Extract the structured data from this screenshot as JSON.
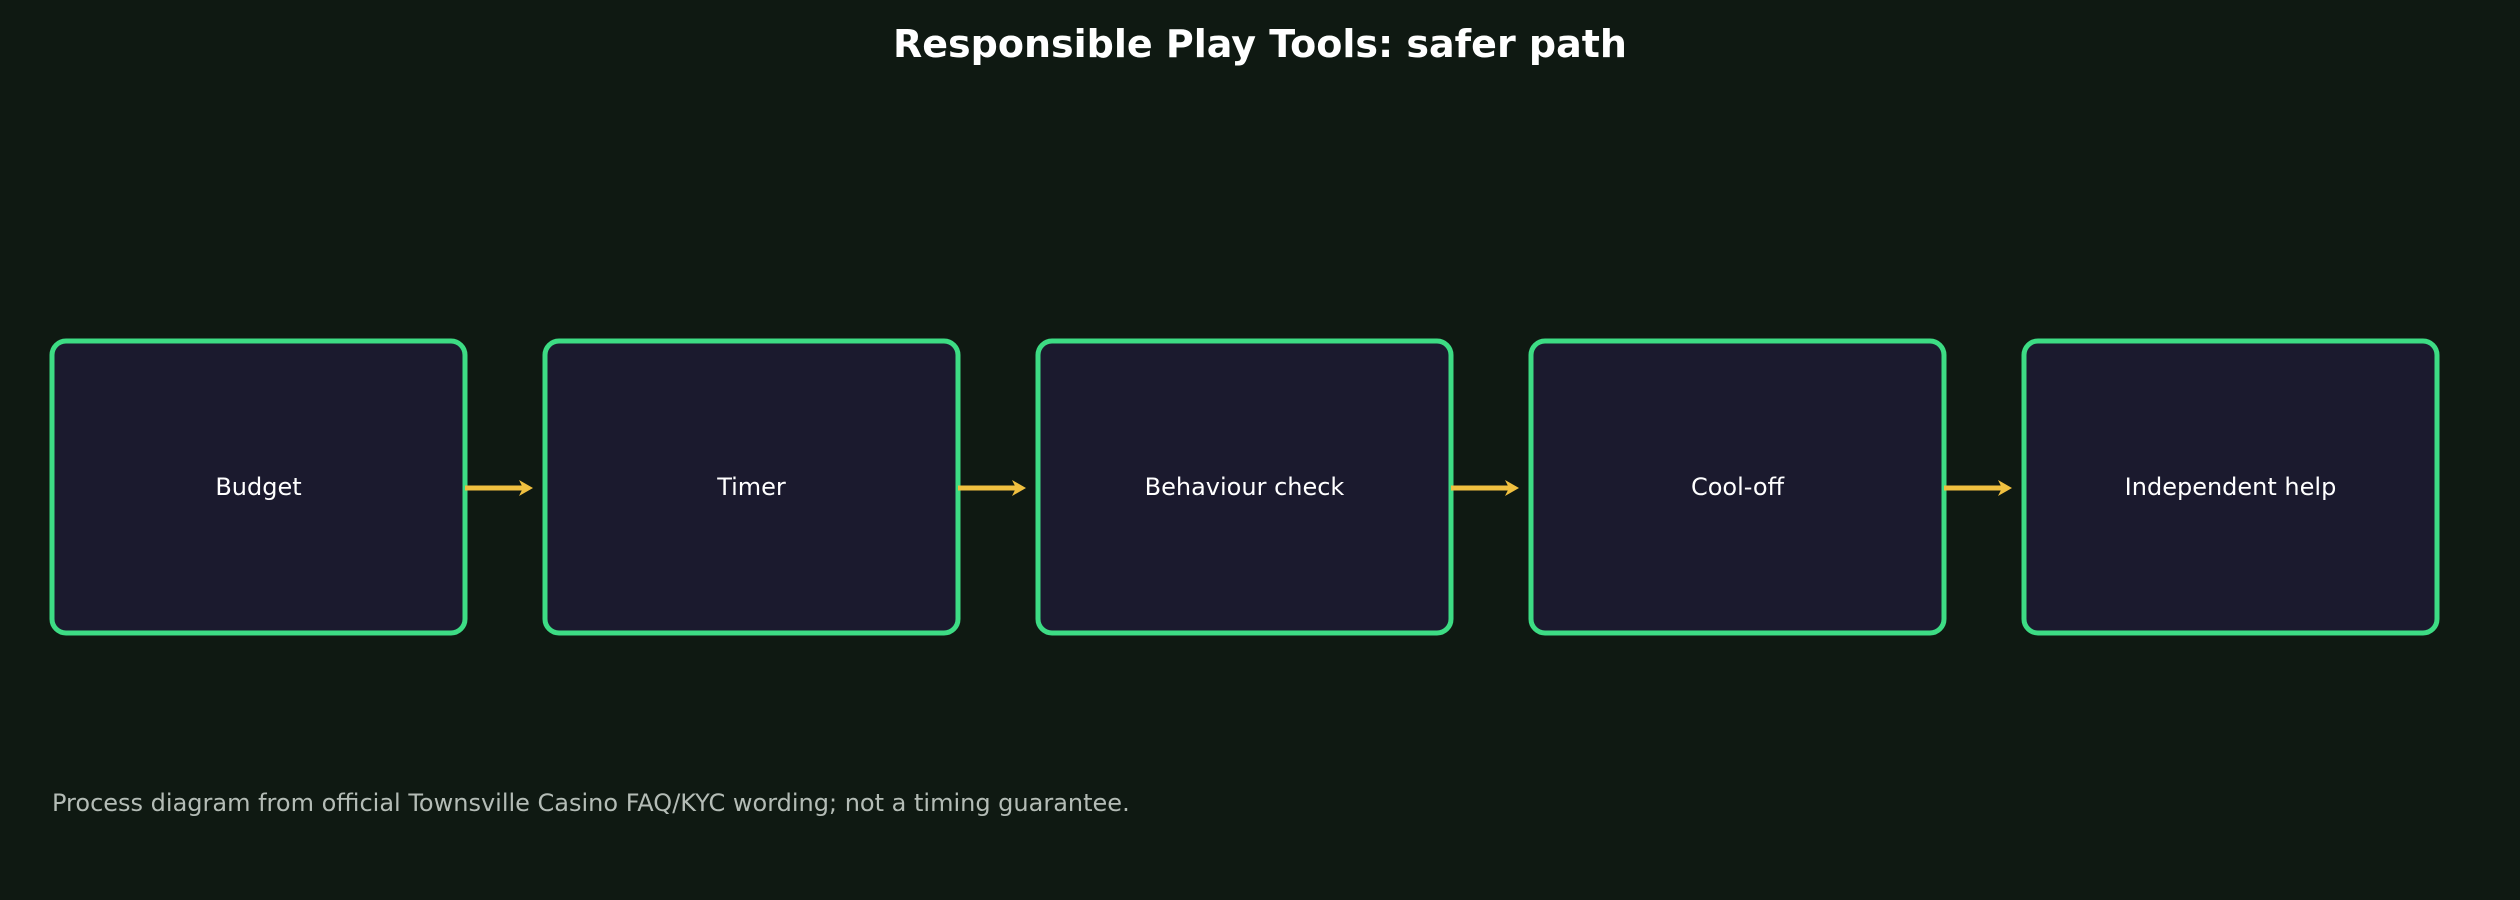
{
  "title": "Responsible Play Tools: safer path",
  "steps": [
    {
      "label": "Budget"
    },
    {
      "label": "Timer"
    },
    {
      "label": "Behaviour check"
    },
    {
      "label": "Cool-off"
    },
    {
      "label": "Independent help"
    }
  ],
  "footnote": "Process diagram from official Townsville Casino FAQ/KYC wording; not a timing guarantee.",
  "colors": {
    "background": "#0f1912",
    "box_fill": "#1b1a2e",
    "box_border": "#3ddc84",
    "arrow": "#f0c040",
    "text": "#ffffff",
    "footnote_text": "#b4bcb6"
  }
}
